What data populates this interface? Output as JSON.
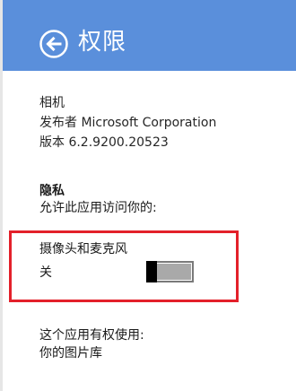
{
  "header": {
    "title": "权限",
    "back_icon": "back-arrow-circle-icon",
    "background_color": "#5a8fdb"
  },
  "app_info": {
    "name": "相机",
    "publisher": "发布者 Microsoft Corporation",
    "version": "版本 6.2.9200.20523"
  },
  "privacy": {
    "title": "隐私",
    "description": "允许此应用访问你的:"
  },
  "settings": [
    {
      "label": "摄像头和麦克风",
      "state_label": "关",
      "enabled": false
    }
  ],
  "rights": {
    "heading": "这个应用有权使用:",
    "items": [
      "你的图片库"
    ]
  },
  "highlight_color": "#e3202a"
}
